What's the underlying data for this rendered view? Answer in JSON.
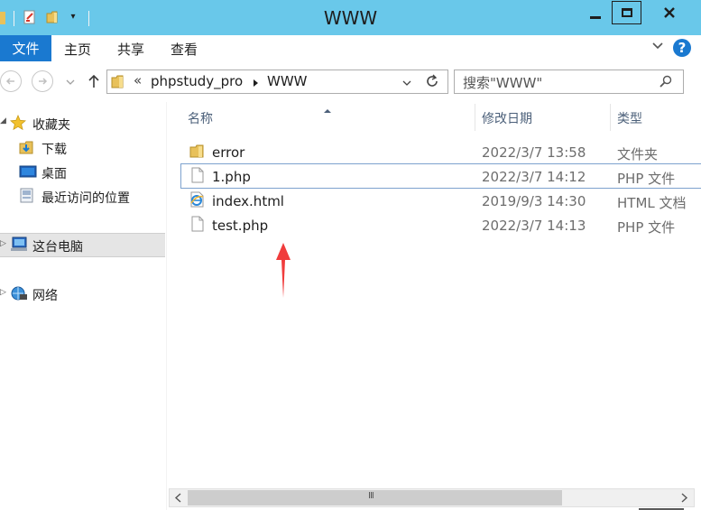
{
  "window": {
    "title": "WWW",
    "controls": {
      "minimize": "—",
      "maximize": "□",
      "close": "✕"
    }
  },
  "ribbon": {
    "tabs": [
      "文件",
      "主页",
      "共享",
      "查看"
    ],
    "help": "?",
    "collapse": "⌄"
  },
  "address": {
    "overflow": "«",
    "crumbs": [
      "phpstudy_pro",
      "WWW"
    ],
    "search_placeholder": "搜索\"WWW\""
  },
  "nav": {
    "favorites": "收藏夹",
    "favorite_items": [
      "下载",
      "桌面",
      "最近访问的位置"
    ],
    "this_pc": "这台电脑",
    "network": "网络"
  },
  "columns": {
    "name": "名称",
    "date": "修改日期",
    "type": "类型"
  },
  "files": [
    {
      "name": "error",
      "date": "2022/3/7 13:58",
      "type": "文件夹",
      "icon": "folder-icon"
    },
    {
      "name": "1.php",
      "date": "2022/3/7 14:12",
      "type": "PHP 文件",
      "icon": "file-icon"
    },
    {
      "name": "index.html",
      "date": "2019/9/3 14:30",
      "type": "HTML 文档",
      "icon": "ie-html-icon"
    },
    {
      "name": "test.php",
      "date": "2022/3/7 14:13",
      "type": "PHP 文件",
      "icon": "file-icon"
    }
  ],
  "scrollbar": {
    "grip": "III"
  },
  "colors": {
    "titlebar": "#69c8ea",
    "file_tab": "#1a79d0",
    "selection_border": "#7da2ce",
    "annotation_arrow": "#f03c3c"
  }
}
